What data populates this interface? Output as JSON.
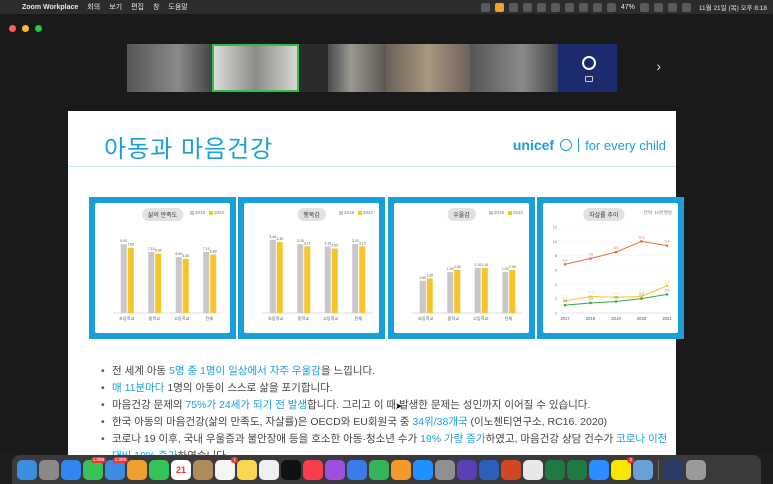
{
  "menubar": {
    "app_name": "Zoom Workplace",
    "menus": [
      "회의",
      "보기",
      "편집",
      "창",
      "도움말"
    ],
    "battery": "47%",
    "datetime": "11월 21일 (목) 오후 8:18"
  },
  "slide": {
    "title": "아동과 마음건강",
    "logo_brand": "unicef",
    "logo_tagline": "for every child",
    "charts_meta": [
      {
        "title": "삶의 만족도",
        "legend": [
          "2018",
          "2022"
        ]
      },
      {
        "title": "행복감",
        "legend": [
          "2018",
          "2022"
        ]
      },
      {
        "title": "우울감",
        "legend": [
          "2018",
          "2022"
        ]
      },
      {
        "title": "자살률 추이",
        "legend": [
          "단위: 10만명당"
        ]
      }
    ],
    "bullets": [
      {
        "parts": [
          {
            "t": "전 세계 아동 "
          },
          {
            "t": "5명 중 1명이 일상에서 자주 우울감",
            "hl": true
          },
          {
            "t": "을 느낍니다."
          }
        ]
      },
      {
        "parts": [
          {
            "t": "매 11분마다",
            "hl": true
          },
          {
            "t": " 1명의 아동이 스스로 삶을 포기합니다."
          }
        ]
      },
      {
        "parts": [
          {
            "t": "마음건강 문제의 "
          },
          {
            "t": "75%가 24세가 되기 전 발생",
            "hl": true
          },
          {
            "t": "합니다. 그리고 이 때 발생한 문제는 성인까지 이어질 수 있습니다."
          }
        ]
      },
      {
        "parts": [
          {
            "t": "한국 아동의 마음건강(삶의 만족도, 자살률)은 OECD와 EU회원국 중 "
          },
          {
            "t": "34위/38개국",
            "hl": true
          },
          {
            "t": " (이노첸티연구소, RC16. 2020)"
          }
        ]
      },
      {
        "parts": [
          {
            "t": "코로나 19 이후, 국내 우울증과 불안장애 등을 호소한 아동·청소년 수가 "
          },
          {
            "t": "19% 가량 증가",
            "hl": true
          },
          {
            "t": "하였고, 마음건강 상담 건수가 "
          },
          {
            "t": "코로나 이전 대비 10% 증가",
            "hl": true
          },
          {
            "t": "하였습니다."
          }
        ]
      }
    ]
  },
  "chart_data": [
    {
      "type": "bar",
      "title": "삶의 만족도",
      "categories": [
        "초등학교",
        "중학교",
        "고등학교",
        "전체"
      ],
      "series": [
        {
          "name": "2018",
          "values": [
            8.0,
            7.1,
            6.5,
            7.1
          ]
        },
        {
          "name": "2022",
          "values": [
            7.6,
            6.9,
            6.3,
            6.8
          ]
        }
      ],
      "ylim": [
        0,
        10
      ]
    },
    {
      "type": "bar",
      "title": "행복감",
      "categories": [
        "초등학교",
        "중학교",
        "고등학교",
        "전체"
      ],
      "series": [
        {
          "name": "2018",
          "values": [
            3.4,
            3.2,
            3.1,
            3.2
          ]
        },
        {
          "name": "2022",
          "values": [
            3.3,
            3.1,
            3.0,
            3.1
          ]
        }
      ],
      "ylim": [
        0,
        4
      ]
    },
    {
      "type": "bar",
      "title": "우울감",
      "categories": [
        "초등학교",
        "중학교",
        "고등학교",
        "전체"
      ],
      "series": [
        {
          "name": "2018",
          "values": [
            1.5,
            1.9,
            2.1,
            1.9
          ]
        },
        {
          "name": "2022",
          "values": [
            1.6,
            2.0,
            2.1,
            2.0
          ]
        }
      ],
      "ylim": [
        0,
        4
      ]
    },
    {
      "type": "line",
      "title": "자살률 추이",
      "x": [
        "2017",
        "2018",
        "2019",
        "2020",
        "2021"
      ],
      "series": [
        {
          "values": [
            6.8,
            7.6,
            8.5,
            10.0,
            9.4
          ]
        },
        {
          "values": [
            1.7,
            2.3,
            2.2,
            2.3,
            3.8
          ]
        },
        {
          "values": [
            1.1,
            1.4,
            1.6,
            2.0,
            2.6
          ]
        }
      ],
      "ylim": [
        0,
        12
      ],
      "yticks": [
        "0",
        "2",
        "4",
        "6",
        "8",
        "10",
        "12"
      ]
    }
  ],
  "colors": {
    "accent": "#1aa0d8",
    "bar_2018": "#c8c8c8",
    "bar_2022": "#f6c42b",
    "line_red": "#e0703a",
    "line_yellow": "#f6c42b",
    "line_green": "#39a845"
  },
  "dock": {
    "icons": [
      "finder-icon",
      "launchpad-icon",
      "safari-icon",
      "messages-icon",
      "mail-icon",
      "photos-icon",
      "facetime-icon",
      "calendar-icon",
      "contacts-icon",
      "reminders-icon",
      "notes-icon",
      "freeform-icon",
      "tv-icon",
      "music-icon",
      "podcasts-icon",
      "keynote-icon",
      "numbers-icon",
      "pages-icon",
      "appstore-icon",
      "settings-icon",
      "obsidian-icon",
      "word-icon",
      "powerpoint-icon",
      "chrome-icon",
      "excel-helper-icon",
      "excel-icon",
      "zoom-icon",
      "kakaotalk-icon",
      "preview-icon",
      "app-icon",
      "trash-icon"
    ],
    "calendar_day": "21",
    "badges": {
      "messages": "1,098",
      "mail": "1,009",
      "reminders": "1",
      "kakaotalk": "2"
    }
  }
}
